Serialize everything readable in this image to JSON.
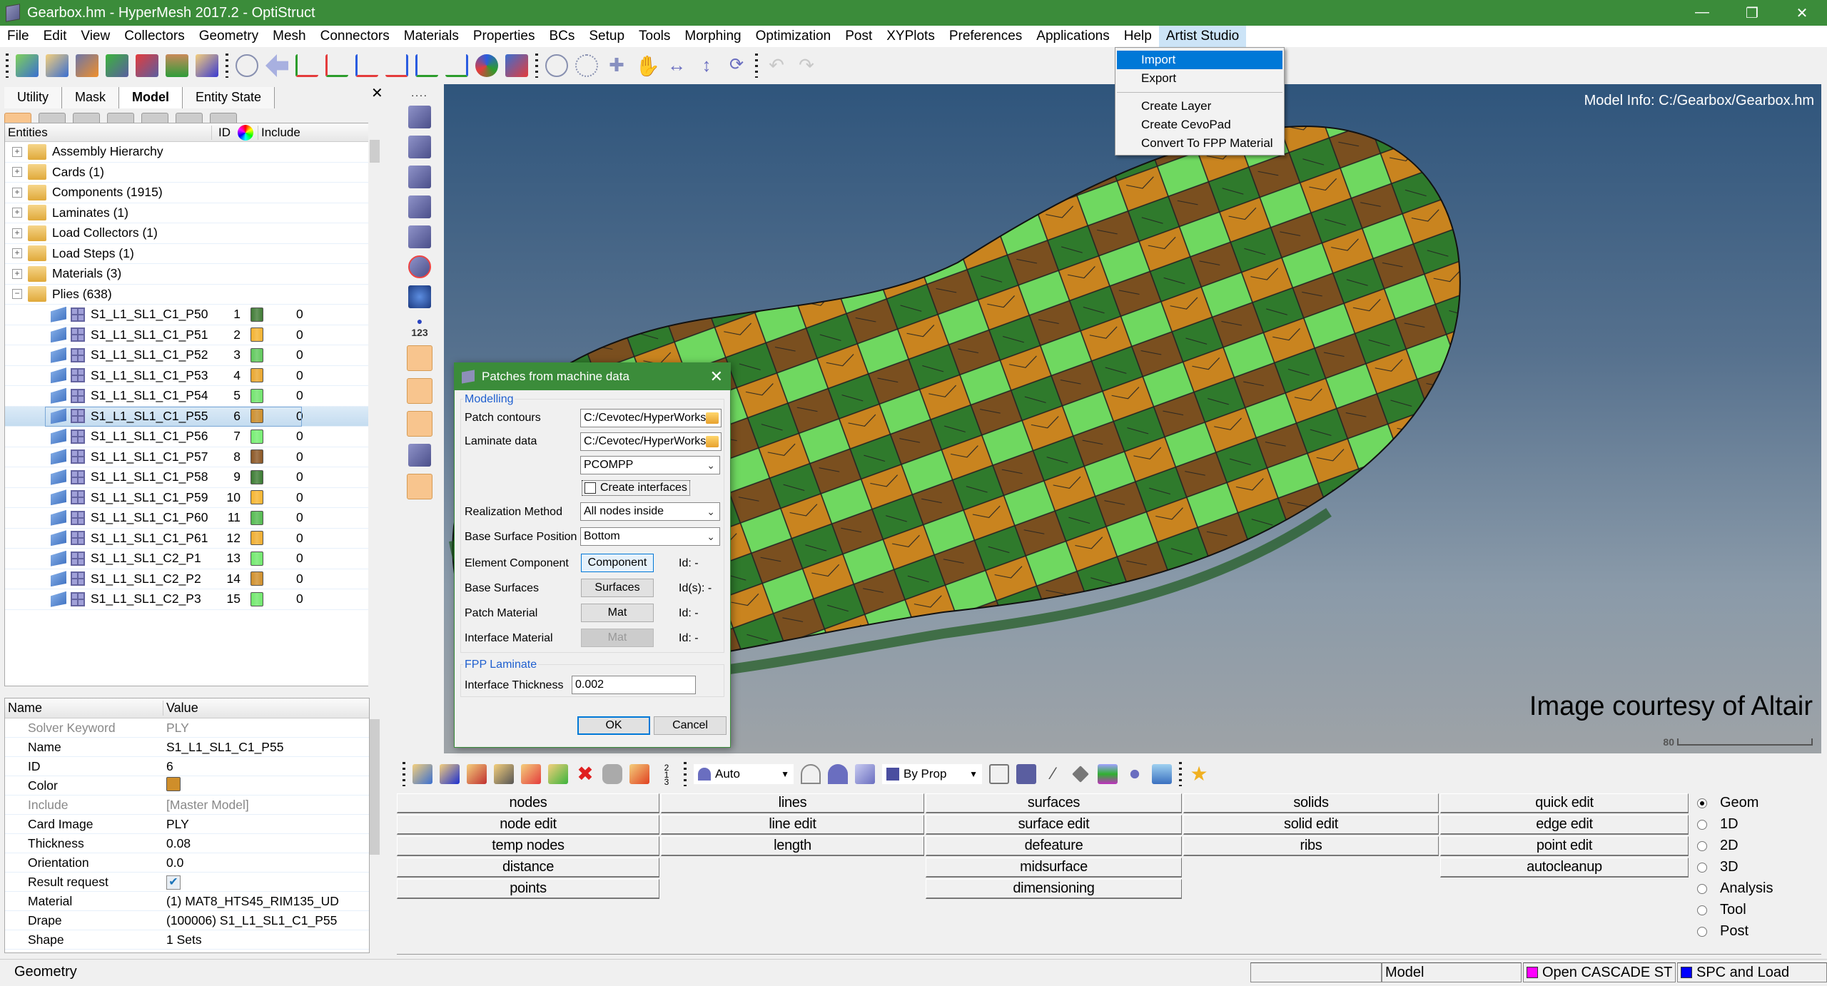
{
  "window": {
    "title": "Gearbox.hm - HyperMesh 2017.2 - OptiStruct",
    "controls": [
      "minimize",
      "restore",
      "close"
    ]
  },
  "menubar": {
    "items": [
      "File",
      "Edit",
      "View",
      "Collectors",
      "Geometry",
      "Mesh",
      "Connectors",
      "Materials",
      "Properties",
      "BCs",
      "Setup",
      "Tools",
      "Morphing",
      "Optimization",
      "Post",
      "XYPlots",
      "Preferences",
      "Applications",
      "Help",
      "Artist Studio"
    ],
    "active": "Artist Studio"
  },
  "artist_menu": {
    "items": [
      {
        "label": "Import",
        "highlighted": true
      },
      {
        "label": "Export"
      },
      {
        "separator": true
      },
      {
        "label": "Create Layer"
      },
      {
        "label": "Create CevoPad"
      },
      {
        "label": "Convert To FPP Material"
      }
    ]
  },
  "left_panel": {
    "tabs": [
      "Utility",
      "Mask",
      "Model",
      "Entity State"
    ],
    "active_tab": "Model",
    "search": {
      "value": "",
      "placeholder": ""
    },
    "tree": {
      "headers": {
        "entities": "Entities",
        "id": "ID",
        "include": "Include"
      },
      "groups": [
        {
          "label": "Assembly Hierarchy",
          "expanded": false
        },
        {
          "label": "Cards (1)",
          "expanded": false
        },
        {
          "label": "Components (1915)",
          "expanded": false
        },
        {
          "label": "Laminates (1)",
          "expanded": false
        },
        {
          "label": "Load Collectors (1)",
          "expanded": false
        },
        {
          "label": "Load Steps (1)",
          "expanded": false
        },
        {
          "label": "Materials (3)",
          "expanded": false
        },
        {
          "label": "Plies (638)",
          "expanded": true
        }
      ],
      "plies": [
        {
          "name": "S1_L1_SL1_C1_P50",
          "id": "1",
          "color": "#3f7a34",
          "include": "0"
        },
        {
          "name": "S1_L1_SL1_C1_P51",
          "id": "2",
          "color": "#f3b12e",
          "include": "0"
        },
        {
          "name": "S1_L1_SL1_C1_P52",
          "id": "3",
          "color": "#5ec75a",
          "include": "0"
        },
        {
          "name": "S1_L1_SL1_C1_P53",
          "id": "4",
          "color": "#e9a52c",
          "include": "0"
        },
        {
          "name": "S1_L1_SL1_C1_P54",
          "id": "5",
          "color": "#6fe36b",
          "include": "0"
        },
        {
          "name": "S1_L1_SL1_C1_P55",
          "id": "6",
          "color": "#cf8e2a",
          "include": "0",
          "selected": true
        },
        {
          "name": "S1_L1_SL1_C1_P56",
          "id": "7",
          "color": "#74ee70",
          "include": "0"
        },
        {
          "name": "S1_L1_SL1_C1_P57",
          "id": "8",
          "color": "#8a5523",
          "include": "0"
        },
        {
          "name": "S1_L1_SL1_C1_P58",
          "id": "9",
          "color": "#3a7a31",
          "include": "0"
        },
        {
          "name": "S1_L1_SL1_C1_P59",
          "id": "10",
          "color": "#f6b42e",
          "include": "0"
        },
        {
          "name": "S1_L1_SL1_C1_P60",
          "id": "11",
          "color": "#52b94e",
          "include": "0"
        },
        {
          "name": "S1_L1_SL1_C1_P61",
          "id": "12",
          "color": "#efac2d",
          "include": "0"
        },
        {
          "name": "S1_L1_SL1_C2_P1",
          "id": "13",
          "color": "#6fe86b",
          "include": "0"
        },
        {
          "name": "S1_L1_SL1_C2_P2",
          "id": "14",
          "color": "#cf8e2a",
          "include": "0"
        },
        {
          "name": "S1_L1_SL1_C2_P3",
          "id": "15",
          "color": "#6fe86b",
          "include": "0"
        }
      ]
    },
    "properties": {
      "headers": {
        "name": "Name",
        "value": "Value"
      },
      "rows": [
        {
          "key": "Solver Keyword",
          "value": "PLY",
          "dim": true
        },
        {
          "key": "Name",
          "value": "S1_L1_SL1_C1_P55"
        },
        {
          "key": "ID",
          "value": "6"
        },
        {
          "key": "Color",
          "swatch": "#cf8e2a"
        },
        {
          "key": "Include",
          "value": "[Master Model]",
          "dim": true
        },
        {
          "key": "Card Image",
          "value": "PLY"
        },
        {
          "key": "Thickness",
          "value": "0.08"
        },
        {
          "key": "Orientation",
          "value": "0.0"
        },
        {
          "key": "Result request",
          "checked": true
        },
        {
          "key": "Material",
          "value": "(1) MAT8_HTS45_RIM135_UD"
        },
        {
          "key": "Drape",
          "value": "(100006) S1_L1_SL1_C1_P55"
        },
        {
          "key": "Shape",
          "value": "1 Sets"
        }
      ]
    }
  },
  "viewport": {
    "model_info": "Model Info: C:/Gearbox/Gearbox.hm",
    "courtesy": "Image courtesy of Altair",
    "scale_label": "80"
  },
  "dialog": {
    "title": "Patches from machine data",
    "modelling_group": "Modelling",
    "patch_contours_label": "Patch contours",
    "patch_contours_value": "C:/Cevotec/HyperWorks",
    "laminate_data_label": "Laminate data",
    "laminate_data_value": "C:/Cevotec/HyperWorks",
    "card_type": "PCOMPP",
    "create_interfaces_label": "Create interfaces",
    "create_interfaces_checked": false,
    "realization_label": "Realization Method",
    "realization_value": "All nodes inside",
    "base_position_label": "Base Surface Position",
    "base_position_value": "Bottom",
    "element_component_label": "Element Component",
    "element_component_btn": "Component",
    "element_component_id": "Id: -",
    "base_surfaces_label": "Base Surfaces",
    "base_surfaces_btn": "Surfaces",
    "base_surfaces_id": "Id(s): -",
    "patch_material_label": "Patch Material",
    "patch_material_btn": "Mat",
    "patch_material_id": "Id: -",
    "interface_material_label": "Interface Material",
    "interface_material_btn": "Mat",
    "interface_material_id": "Id: -",
    "fpp_group": "FPP Laminate",
    "interface_thickness_label": "Interface Thickness",
    "interface_thickness_value": "0.002",
    "ok": "OK",
    "cancel": "Cancel"
  },
  "bottom_toolbar": {
    "vis_mode": "Auto",
    "color_mode": "By Prop"
  },
  "geom_panel": {
    "columns": [
      [
        "nodes",
        "node edit",
        "temp nodes",
        "distance",
        "points"
      ],
      [
        "lines",
        "line edit",
        "length"
      ],
      [
        "surfaces",
        "surface edit",
        "defeature",
        "midsurface",
        "dimensioning"
      ],
      [
        "solids",
        "solid edit",
        "ribs"
      ],
      [
        "quick edit",
        "edge edit",
        "point edit",
        "autocleanup"
      ]
    ],
    "radios": [
      "Geom",
      "1D",
      "2D",
      "3D",
      "Analysis",
      "Tool",
      "Post"
    ],
    "selected_radio": "Geom"
  },
  "statusbar": {
    "left": "Geometry",
    "cells": [
      {
        "label": ""
      },
      {
        "label": "Model"
      },
      {
        "label": "Open CASCADE ST",
        "color": "#ff00ff"
      },
      {
        "label": "SPC and Load",
        "color": "#0000ff"
      }
    ]
  }
}
